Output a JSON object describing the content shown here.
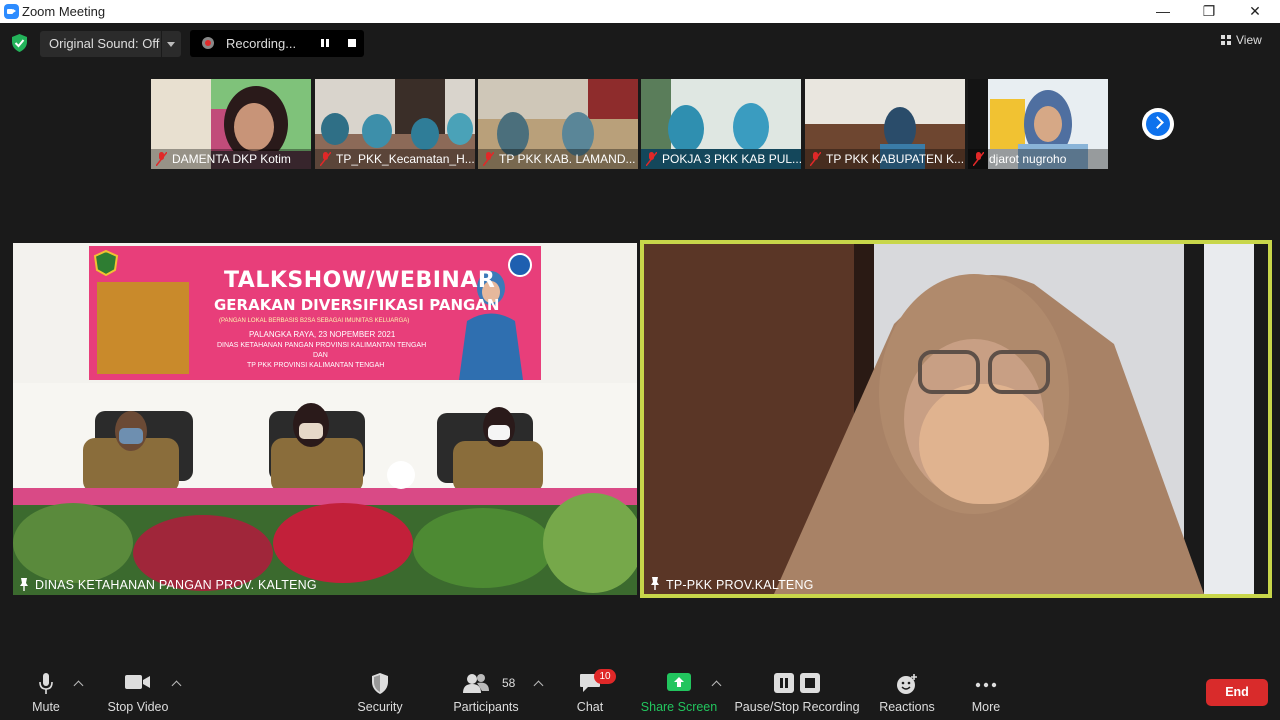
{
  "window": {
    "title": "Zoom Meeting",
    "controls": {
      "minimize": "—",
      "restore": "❐",
      "close": "✕"
    }
  },
  "top_bar": {
    "original_sound": "Original Sound: Off",
    "recording_status": "Recording...",
    "view_label": "View"
  },
  "gallery": [
    {
      "name": "DAMENTA DKP Kotim"
    },
    {
      "name": "TP_PKK_Kecamatan_H..."
    },
    {
      "name": "TP PKK KAB. LAMAND..."
    },
    {
      "name": "POKJA 3 PKK KAB PUL..."
    },
    {
      "name": "TP PKK KABUPATEN K..."
    },
    {
      "name": "djarot nugroho"
    }
  ],
  "videos": {
    "left": {
      "label": "DINAS KETAHANAN PANGAN PROV. KALTENG",
      "banner": {
        "line1": "TALKSHOW/WEBINAR",
        "line2": "GERAKAN DIVERSIFIKASI PANGAN",
        "line3": "(PANGAN LOKAL BERBASIS B2SA SEBAGAI IMUNITAS KELUARGA)",
        "line4": "PALANGKA RAYA, 23 NOPEMBER 2021",
        "line5": "DINAS KETAHANAN PANGAN PROVINSI KALIMANTAN TENGAH",
        "line6": "DAN",
        "line7": "TP PKK PROVINSI KALIMANTAN TENGAH"
      }
    },
    "right": {
      "label": "TP-PKK PROV.KALTENG"
    }
  },
  "toolbar": {
    "mute": "Mute",
    "stop_video": "Stop Video",
    "security": "Security",
    "participants": "Participants",
    "participants_count": "58",
    "chat": "Chat",
    "chat_badge": "10",
    "share_screen": "Share Screen",
    "pause_stop_recording": "Pause/Stop Recording",
    "reactions": "Reactions",
    "more": "More",
    "end": "End"
  },
  "colors": {
    "accent_green": "#22c55e",
    "end_red": "#d92b2b",
    "active_speaker": "#c8d64a",
    "zoom_blue": "#0e72ed"
  }
}
